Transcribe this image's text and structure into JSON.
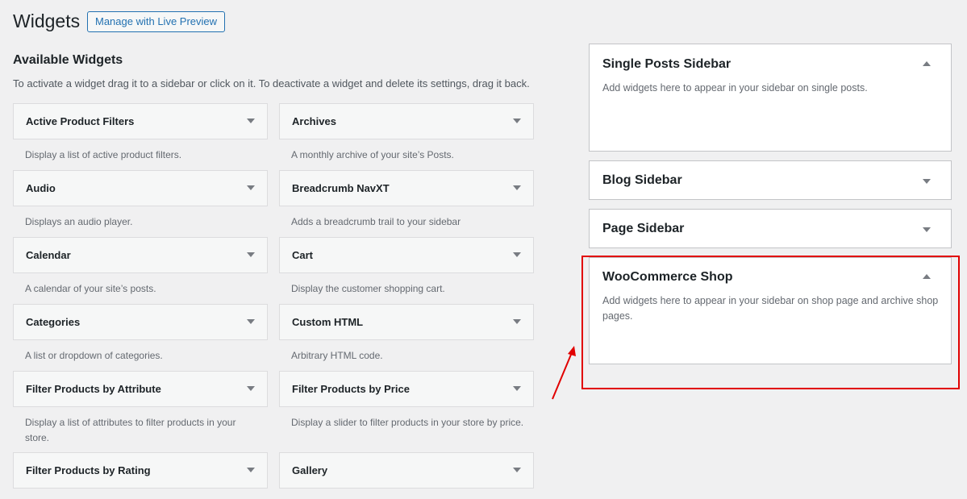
{
  "header": {
    "title": "Widgets",
    "live_preview_label": "Manage with Live Preview"
  },
  "available": {
    "title": "Available Widgets",
    "description": "To activate a widget drag it to a sidebar or click on it. To deactivate a widget and delete its settings, drag it back."
  },
  "widgets": [
    {
      "title": "Active Product Filters",
      "desc": "Display a list of active product filters."
    },
    {
      "title": "Archives",
      "desc": "A monthly archive of your site’s Posts."
    },
    {
      "title": "Audio",
      "desc": "Displays an audio player."
    },
    {
      "title": "Breadcrumb NavXT",
      "desc": "Adds a breadcrumb trail to your sidebar"
    },
    {
      "title": "Calendar",
      "desc": "A calendar of your site’s posts."
    },
    {
      "title": "Cart",
      "desc": "Display the customer shopping cart."
    },
    {
      "title": "Categories",
      "desc": "A list or dropdown of categories."
    },
    {
      "title": "Custom HTML",
      "desc": "Arbitrary HTML code."
    },
    {
      "title": "Filter Products by Attribute",
      "desc": "Display a list of attributes to filter products in your store."
    },
    {
      "title": "Filter Products by Price",
      "desc": "Display a slider to filter products in your store by price."
    },
    {
      "title": "Filter Products by Rating",
      "desc": ""
    },
    {
      "title": "Gallery",
      "desc": ""
    }
  ],
  "sidebars": [
    {
      "title": "Single Posts Sidebar",
      "desc": "Add widgets here to appear in your sidebar on single posts.",
      "expanded": true
    },
    {
      "title": "Blog Sidebar",
      "desc": "",
      "expanded": false
    },
    {
      "title": "Page Sidebar",
      "desc": "",
      "expanded": false
    },
    {
      "title": "WooCommerce Shop",
      "desc": "Add widgets here to appear in your sidebar on shop page and archive shop pages.",
      "expanded": true
    }
  ],
  "colors": {
    "annotation": "#e10000",
    "accent": "#2271b1"
  }
}
